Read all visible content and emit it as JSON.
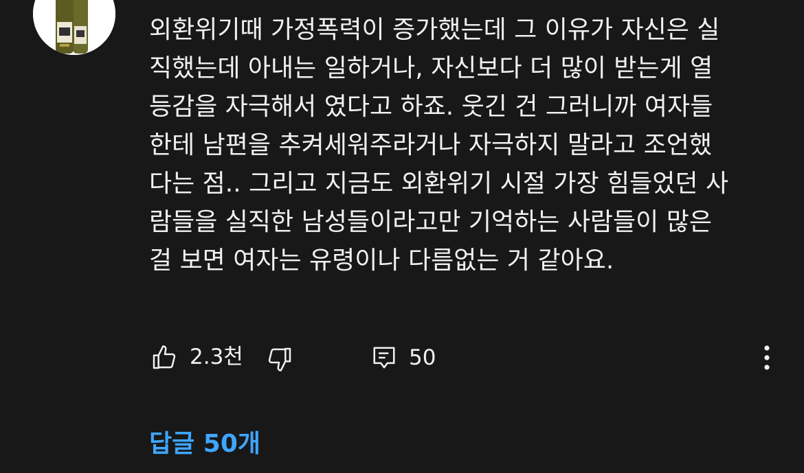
{
  "comment": {
    "avatar_icon": "product-bottles-avatar",
    "lines": [
      "외환위기때 가정폭력이 증가했는데 그 이유가 자신은 실",
      "직했는데 아내는 일하거나, 자신보다 더 많이 받는게 열",
      "등감을 자극해서 였다고 하죠. 웃긴 건 그러니까 여자들",
      "한테 남편을 추켜세워주라거나 자극하지 말라고 조언했",
      "다는 점.. 그리고 지금도 외환위기 시절 가장 힘들었던 사",
      "람들을 실직한 남성들이라고만 기억하는 사람들이 많은",
      "걸 보면 여자는 유령이나 다름없는 거 같아요."
    ],
    "like_count": "2.3천",
    "reply_count": "50",
    "icons": {
      "like": "thumbs-up-icon",
      "dislike": "thumbs-down-icon",
      "reply": "reply-comment-icon",
      "more": "more-vertical-icon"
    }
  },
  "replies": {
    "link_label": "답글 50개"
  },
  "colors": {
    "background": "#181818",
    "text": "#f1f1f1",
    "link": "#3ea6ff"
  }
}
